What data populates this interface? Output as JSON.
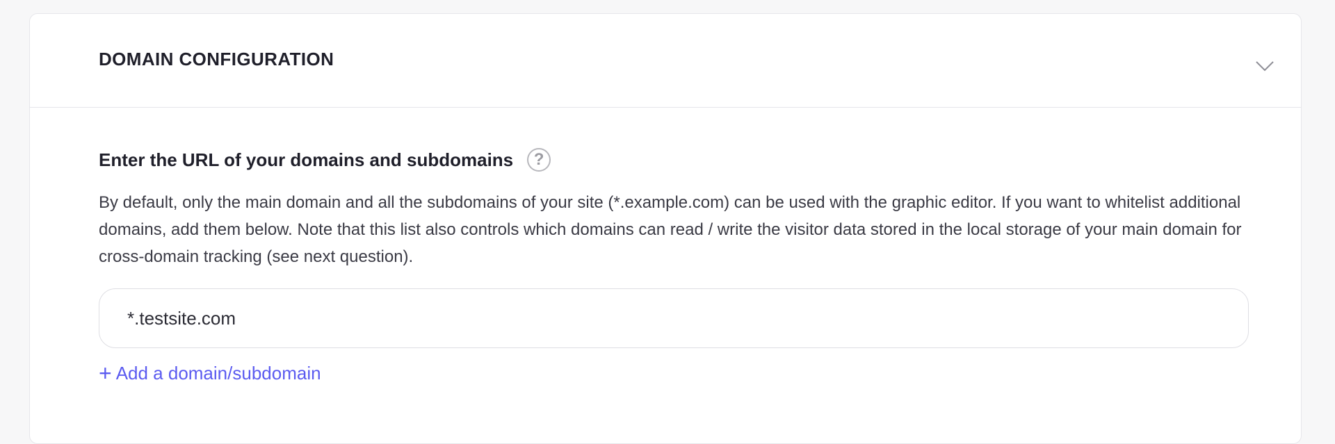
{
  "section": {
    "title": "DOMAIN CONFIGURATION"
  },
  "question": {
    "title": "Enter the URL of your domains and subdomains",
    "help_symbol": "?",
    "description": "By default, only the main domain and all the subdomains of your site (*.example.com) can be used with the graphic editor. If you want to whitelist additional domains, add them below. Note that this list also controls which domains can read / write the visitor data stored in the local storage of your main domain for cross-domain tracking (see next question)."
  },
  "domains": {
    "values": [
      "*.testsite.com"
    ]
  },
  "add_link": {
    "plus": "+",
    "label": "Add a domain/subdomain"
  },
  "icons": {
    "collapse": "chevron-down-icon",
    "help": "question-circle-icon",
    "add": "plus-icon"
  },
  "colors": {
    "accent": "#5b5bf0",
    "text": "#1f1f2a",
    "border": "#e6e6ea"
  }
}
